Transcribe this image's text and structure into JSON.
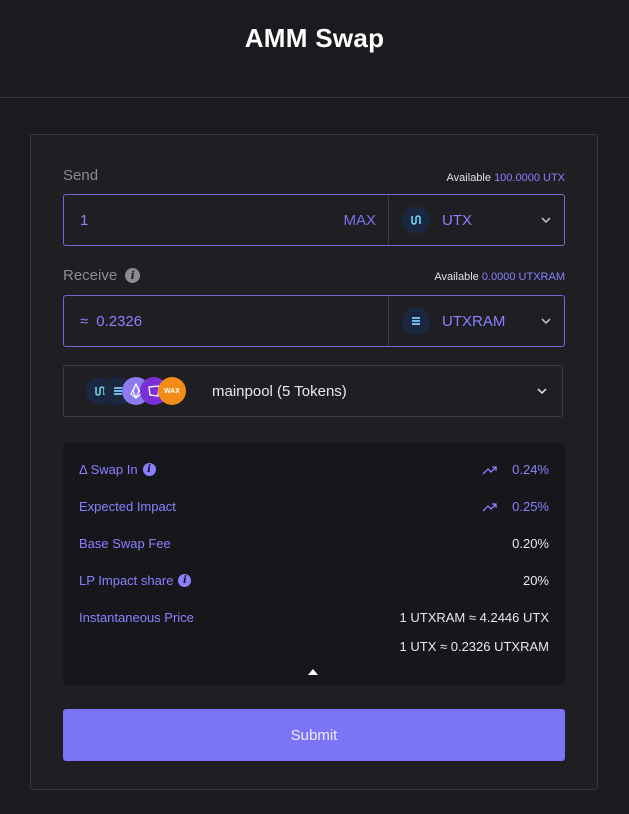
{
  "header": {
    "title": "AMM Swap"
  },
  "send": {
    "label": "Send",
    "available_label": "Available",
    "available_amount": "100.0000 UTX",
    "value": "1",
    "max_label": "MAX",
    "token": "UTX"
  },
  "receive": {
    "label": "Receive",
    "available_label": "Available",
    "available_amount": "0.0000 UTXRAM",
    "prefix": "≈",
    "value": "0.2326",
    "token": "UTXRAM"
  },
  "pool": {
    "name": "mainpool (5 Tokens)",
    "icons": [
      "utx-icon",
      "utxram-icon",
      "eos-icon",
      "purple-token-icon",
      "wax-icon"
    ]
  },
  "details": {
    "swap_in": {
      "label": "Δ Swap In",
      "value": "0.24%"
    },
    "expected_impact": {
      "label": "Expected Impact",
      "value": "0.25%"
    },
    "base_fee": {
      "label": "Base Swap Fee",
      "value": "0.20%"
    },
    "lp_impact": {
      "label": "LP Impact share",
      "value": "20%"
    },
    "price": {
      "label": "Instantaneous Price",
      "line1": "1 UTXRAM ≈ 4.2446 UTX",
      "line2": "1 UTX ≈ 0.2326 UTXRAM"
    }
  },
  "submit_label": "Submit",
  "colors": {
    "accent": "#8a80ff",
    "button": "#7b74f6",
    "background": "#1b1a1f"
  }
}
